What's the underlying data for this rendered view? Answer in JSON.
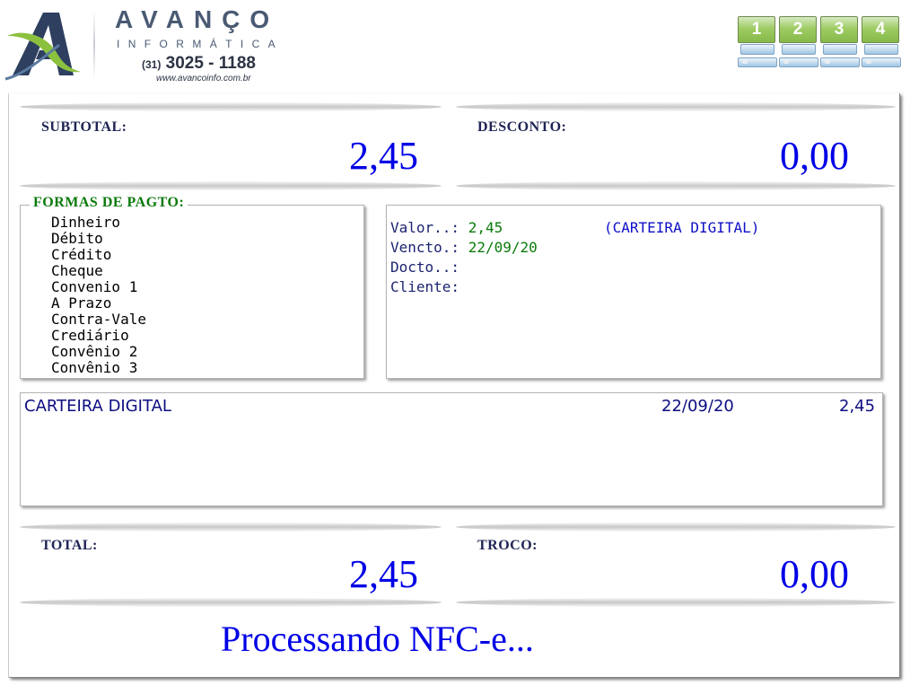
{
  "header": {
    "brand_name": "AVANÇO",
    "brand_sub": "INFORMÁTICA",
    "phone_ddd": "(31)",
    "phone_number": "3025 - 1188",
    "website": "www.avancoinfo.com.br",
    "terminals": [
      "1",
      "2",
      "3",
      "4"
    ]
  },
  "subtotal": {
    "label": "SUBTOTAL:",
    "value": "2,45"
  },
  "desconto": {
    "label": "DESCONTO:",
    "value": "0,00"
  },
  "formas": {
    "legend": "FORMAS DE PAGTO:",
    "items": [
      "Dinheiro",
      "Débito",
      "Crédito",
      "Cheque",
      "Convenio 1",
      "A Prazo",
      "Contra-Vale",
      "Crediário",
      "Convênio 2",
      "Convênio 3"
    ]
  },
  "payment_info": {
    "valor_label": "Valor..:",
    "valor_value": "2,45",
    "wallet": "(CARTEIRA DIGITAL)",
    "vencto_label": "Vencto.:",
    "vencto_value": "22/09/20",
    "docto_label": "Docto..:",
    "cliente_label": "Cliente:"
  },
  "payments": [
    {
      "method": "CARTEIRA DIGITAL",
      "date": "22/09/20",
      "amount": "2,45"
    }
  ],
  "total": {
    "label": "TOTAL:",
    "value": "2,45"
  },
  "troco": {
    "label": "TROCO:",
    "value": "0,00"
  },
  "status": "Processando NFC-e...",
  "colors": {
    "value_blue": "#0000e6",
    "legend_green": "#0b7a0b",
    "label_navy": "#1f2455"
  }
}
